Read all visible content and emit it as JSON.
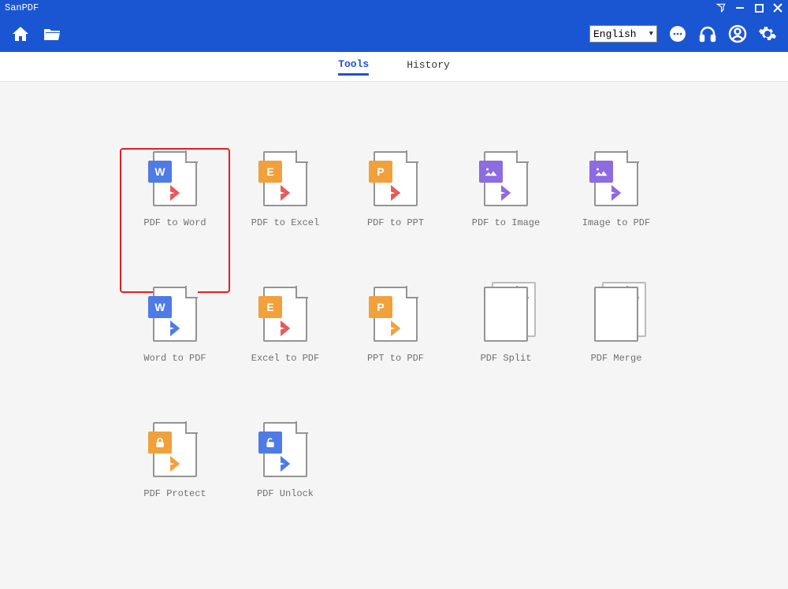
{
  "app": {
    "title": "SanPDF"
  },
  "toolbar": {
    "language": "English"
  },
  "tabs": {
    "tools": "Tools",
    "history": "History"
  },
  "tools": {
    "pdf_to_word": "PDF to Word",
    "pdf_to_excel": "PDF to Excel",
    "pdf_to_ppt": "PDF to PPT",
    "pdf_to_image": "PDF to Image",
    "image_to_pdf": "Image to PDF",
    "word_to_pdf": "Word to PDF",
    "excel_to_pdf": "Excel to PDF",
    "ppt_to_pdf": "PPT to PDF",
    "pdf_split": "PDF Split",
    "pdf_merge": "PDF Merge",
    "pdf_protect": "PDF Protect",
    "pdf_unlock": "PDF Unlock"
  }
}
